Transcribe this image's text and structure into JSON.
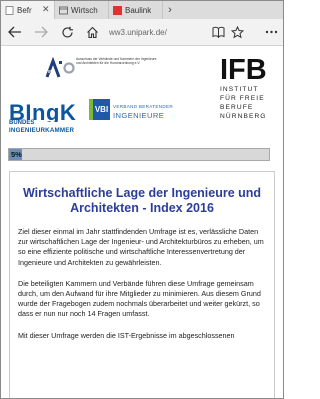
{
  "browser": {
    "tabs": [
      {
        "label": "Befr",
        "active": true
      },
      {
        "label": "Wirtsch",
        "active": false
      },
      {
        "label": "Baulink",
        "active": false
      }
    ],
    "url": "ww3.unipark.de/"
  },
  "logos": {
    "aho_text": "Ausschuss der Verbände und Kammern der Ingenieure und Architekten für die Honorarordnung e.V.",
    "ifb_main": "IFB",
    "ifb_sub": [
      "INSTITUT",
      "FÜR FREIE",
      "BERUFE",
      "NÜRNBERG"
    ],
    "bingk_main": "BIngK",
    "bingk_line1": "BUNDES",
    "bingk_line2": "INGENIEURKAMMER",
    "vbi_mark": "VBI",
    "vbi_line1": "VERBAND BERATENDER",
    "vbi_line2": "INGENIEURE"
  },
  "progress": {
    "label": "5%",
    "value": 5
  },
  "content": {
    "title": "Wirtschaftliche Lage der Ingenieure und Architekten - Index 2016",
    "paragraphs": [
      "Ziel dieser einmal im Jahr stattfindenden Umfrage ist es, verlässliche Daten zur wirtschaftlichen Lage der Ingenieur- und Architekturbüros zu erheben, um so eine effiziente politische und wirtschaftliche Interessenvertretung der Ingenieure und Architekten zu gewährleisten.",
      "Die beteiligten Kammern und Verbände führen diese Umfrage gemeinsam durch, um den Aufwand für ihre Mitglieder zu minimieren. Aus diesem Grund wurde der Fragebogen zudem nochmals überarbeitet und weiter gekürzt, so dass er nun nur noch 14 Fragen umfasst.",
      "Mit dieser Umfrage werden die IST-Ergebnisse im abgeschlossenen"
    ]
  }
}
